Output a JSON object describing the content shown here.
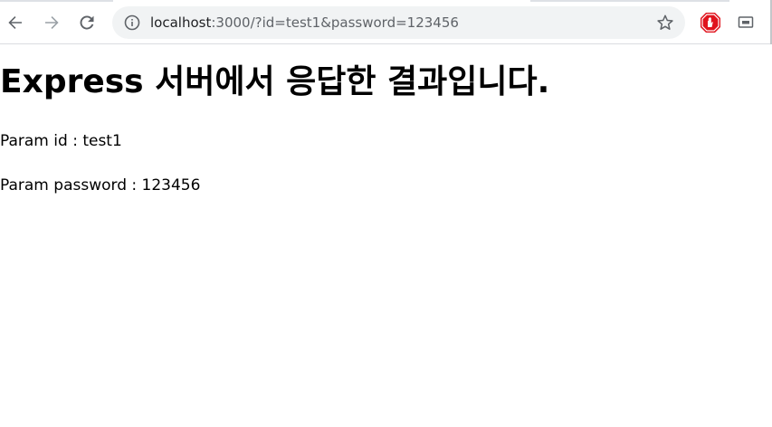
{
  "browser": {
    "url_host": "localhost",
    "url_rest": ":3000/?id=test1&password=123456",
    "icons": {
      "back": "arrow-left-icon",
      "forward": "arrow-right-icon",
      "reload": "reload-icon",
      "info": "info-icon",
      "bookmark": "star-icon",
      "extension_1": "stop-hand-icon",
      "extension_2": "cast-icon"
    },
    "colors": {
      "toolbar_bg": "#ffffff",
      "omnibox_bg": "#f1f3f4",
      "icon": "#5f6368",
      "disabled_icon": "#9aa0a6",
      "extension_red": "#e0141e"
    }
  },
  "page": {
    "heading": "Express 서버에서 응답한 결과입니다.",
    "param_id": "Param id : test1",
    "param_password": "Param password : 123456"
  }
}
